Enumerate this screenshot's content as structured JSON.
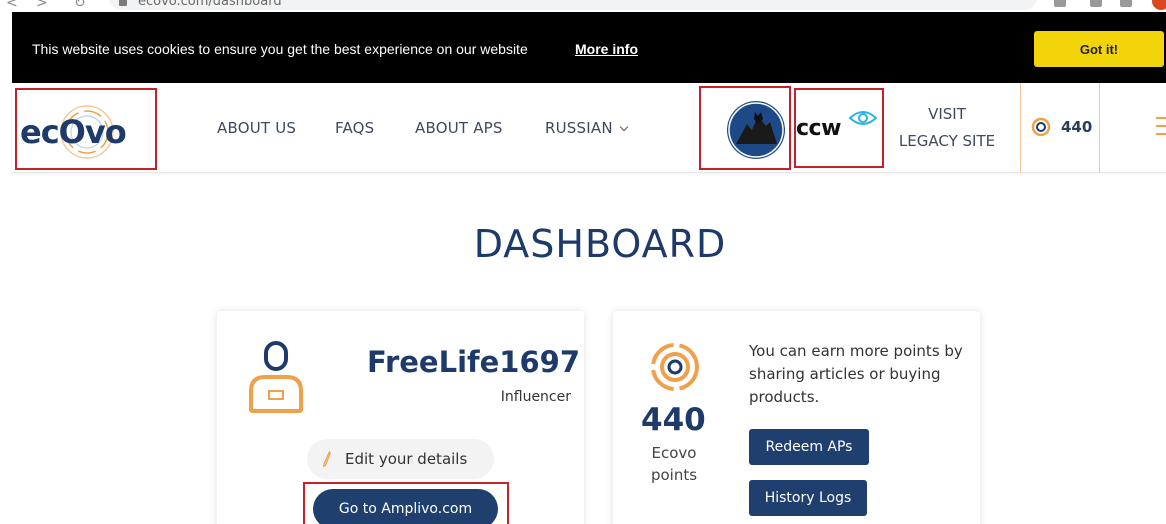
{
  "browser": {
    "url": "ecovo.com/dashboard"
  },
  "cookie_banner": {
    "message": "This website uses cookies to ensure you get the best experience on our website",
    "link_label": "More info",
    "button_label": "Got it!"
  },
  "header": {
    "logo_text": "ecOvo",
    "nav": [
      {
        "label": "ABOUT US"
      },
      {
        "label": "FAQS"
      },
      {
        "label": "ABOUT APS"
      },
      {
        "label": "RUSSIAN"
      }
    ],
    "partner_logo_text": "ccw",
    "legacy_line1": "VISIT",
    "legacy_line2": "LEGACY SITE",
    "points": "440"
  },
  "dashboard": {
    "title": "DASHBOARD",
    "profile": {
      "username": "FreeLife1697",
      "role": "Influencer",
      "edit_label": "Edit your details",
      "amplivo_label": "Go to Amplivo.com"
    },
    "points_card": {
      "points": "440",
      "label_line1": "Ecovo",
      "label_line2": "points",
      "earn_text": "You can earn more points by sharing articles or buying products.",
      "redeem_label": "Redeem APs",
      "history_label": "History Logs"
    }
  },
  "colors": {
    "brand_navy": "#1f3f6e",
    "accent_orange": "#f0a04a",
    "cookie_button": "#f1d40a",
    "highlight_red": "#c3222a"
  }
}
